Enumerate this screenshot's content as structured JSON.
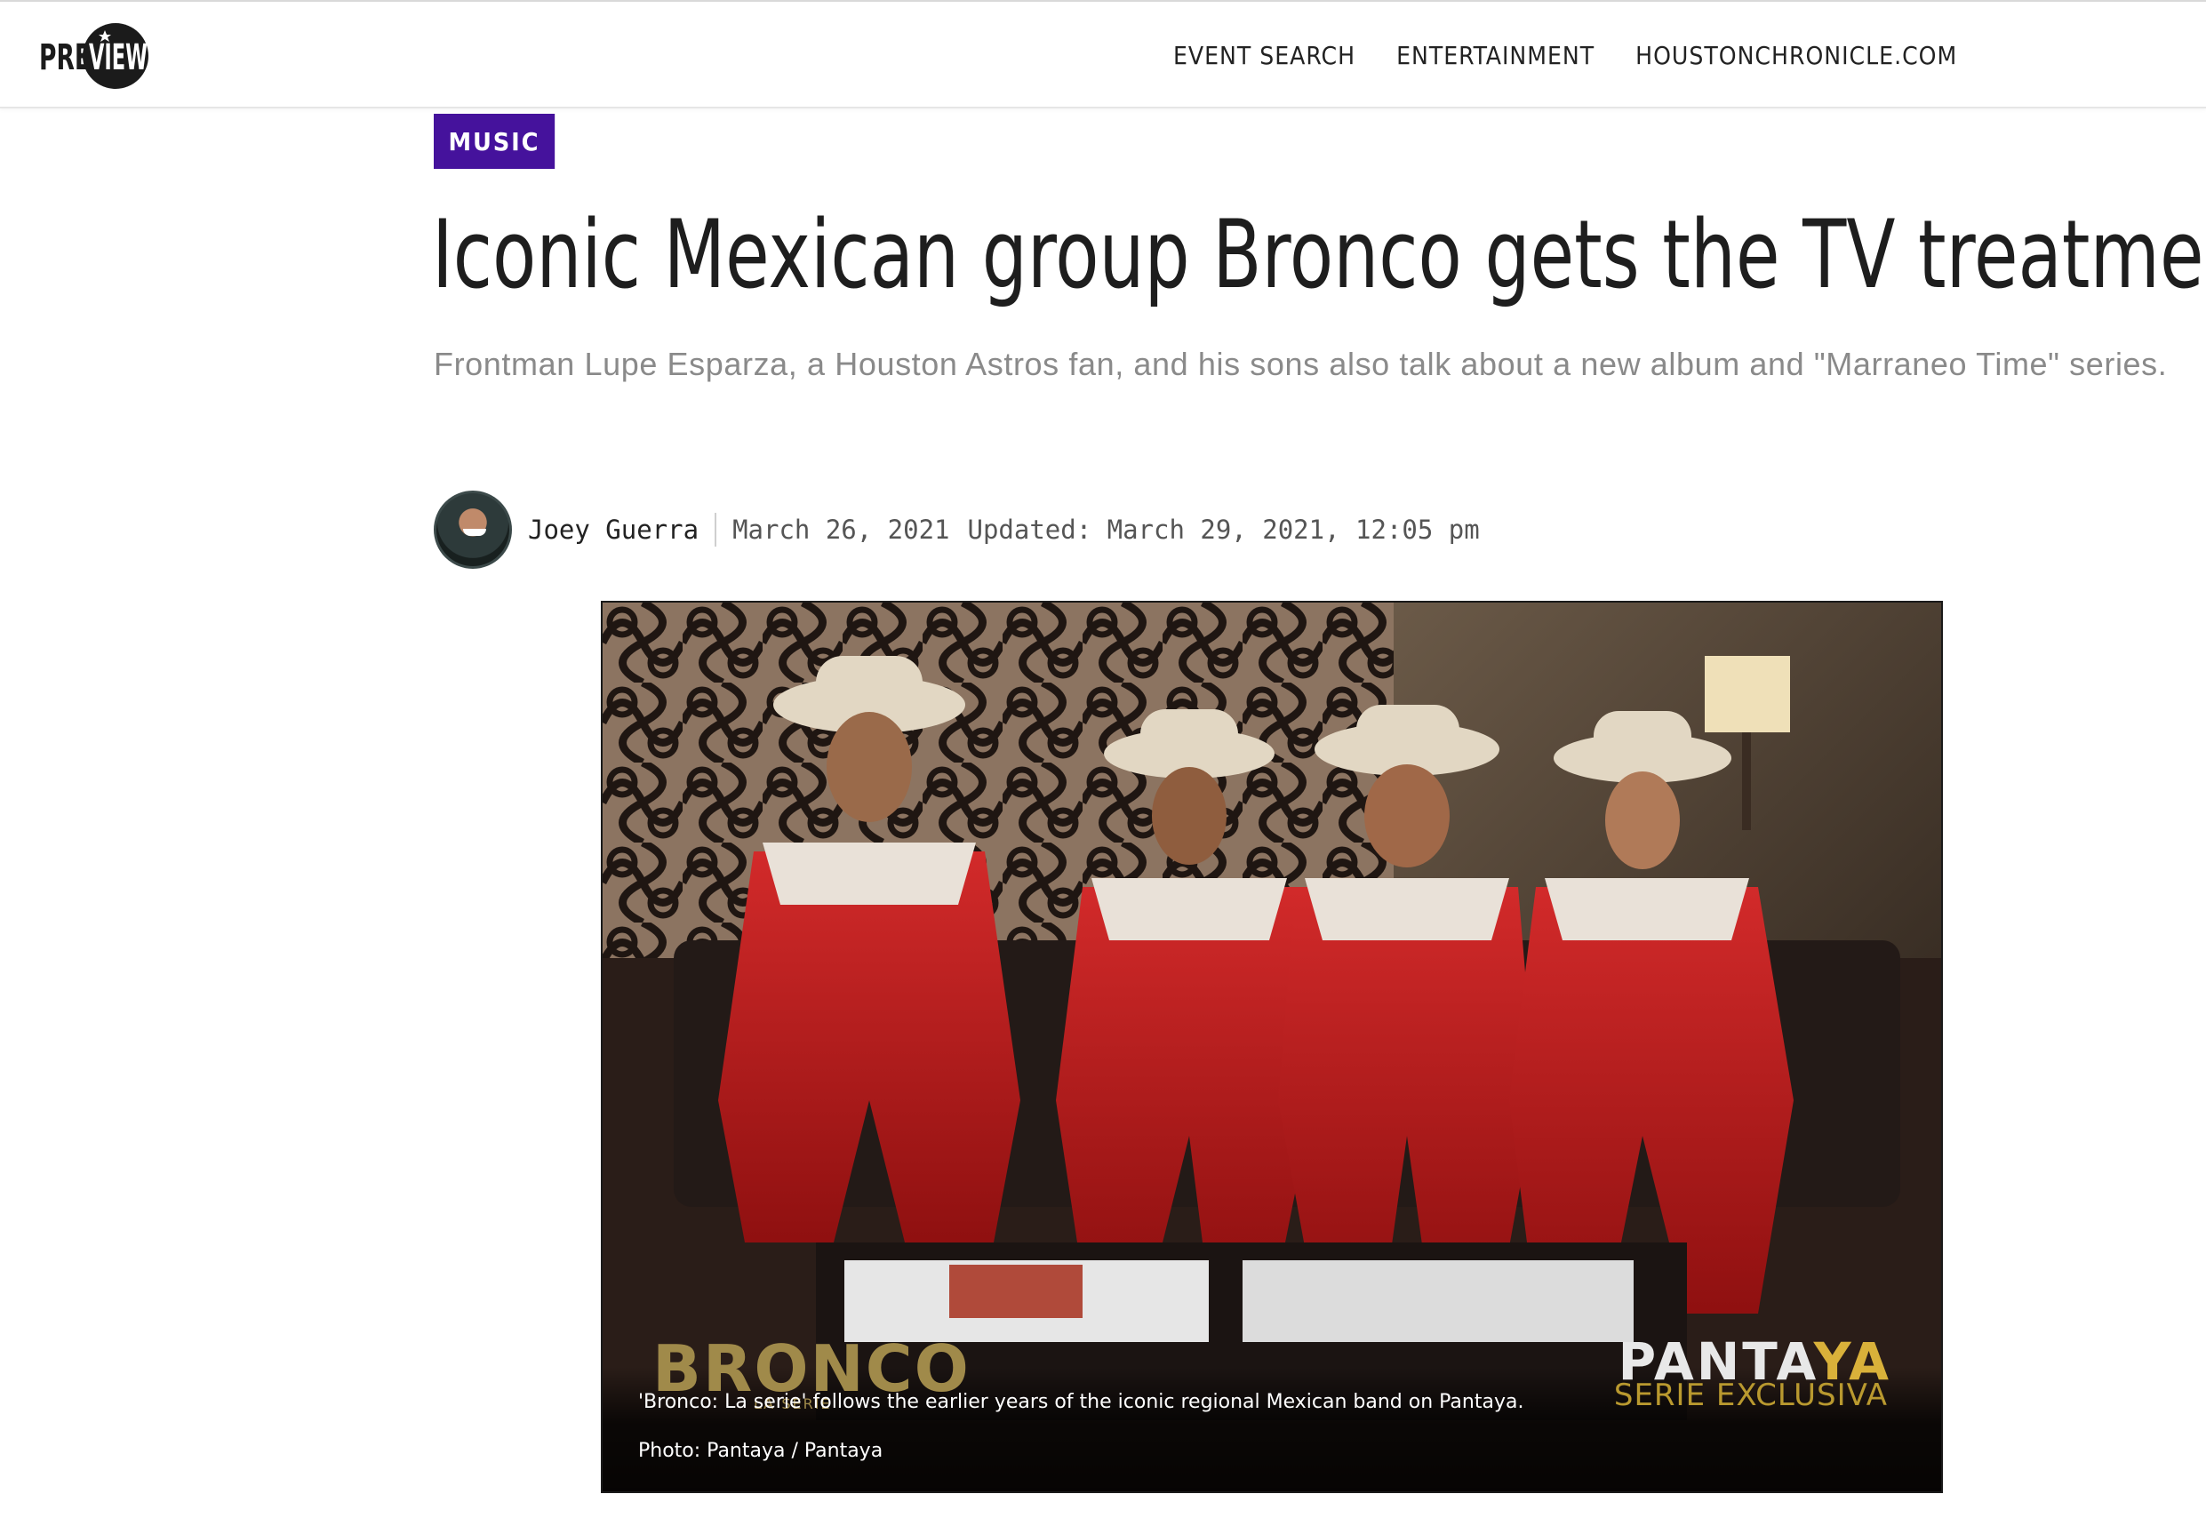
{
  "header": {
    "logo_text": "PREVIEW",
    "nav": [
      {
        "label": "EVENT SEARCH"
      },
      {
        "label": "ENTERTAINMENT"
      },
      {
        "label": "HOUSTONCHRONICLE.COM"
      }
    ]
  },
  "article": {
    "category": "MUSIC",
    "headline": "Iconic Mexican group Bronco gets the TV treatment",
    "subhead": "Frontman Lupe Esparza, a Houston Astros fan, and his sons also talk about a new album and \"Marraneo Time\" series.",
    "author": "Joey Guerra",
    "date": "March 26, 2021",
    "updated": "Updated: March 29, 2021, 12:05 pm",
    "photo": {
      "caption": "'Bronco: La serie' follows the earlier years of the iconic regional Mexican band on Pantaya.",
      "credit": "Photo: Pantaya / Pantaya",
      "overlay_left_logo": "BRONCO",
      "overlay_left_sub": "LA SERIE",
      "overlay_right_logo_a": "PANTA",
      "overlay_right_logo_b": "YA",
      "overlay_right_sub": "SERIE EXCLUSIVA"
    }
  },
  "colors": {
    "category_bg": "#45129c",
    "pantaya_gold": "#d9b13a"
  }
}
